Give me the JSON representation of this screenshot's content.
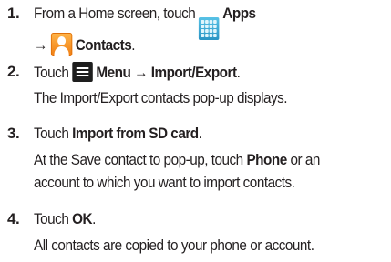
{
  "steps": [
    {
      "number": "1.",
      "line1_prefix": "From a Home screen, touch",
      "apps_icon": "apps-grid-icon",
      "apps_label": "Apps",
      "arrow": "→",
      "contacts_icon": "contacts-icon",
      "contacts_label": "Contacts",
      "period": "."
    },
    {
      "number": "2.",
      "touch": "Touch",
      "menu_icon": "menu-icon",
      "menu_label": "Menu",
      "arrow": "→",
      "target": "Import/Export",
      "period": ".",
      "result": "The Import/Export contacts pop-up displays."
    },
    {
      "number": "3.",
      "touch": "Touch",
      "target": "Import from SD card",
      "period": ".",
      "note_prefix": "At the Save contact to pop-up, touch",
      "note_option": "Phone",
      "note_suffix": "or an",
      "note_line2": "account to which you want to import contacts."
    },
    {
      "number": "4.",
      "touch": "Touch",
      "target": "OK",
      "period": ".",
      "result": "All contacts are copied to your phone or account."
    }
  ]
}
